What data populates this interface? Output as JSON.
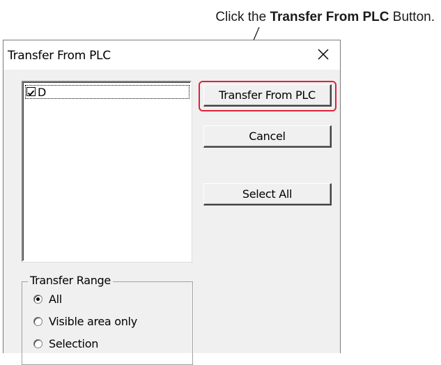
{
  "callout": {
    "prefix": "Click the ",
    "bold": "Transfer From PLC",
    "suffix": " Button."
  },
  "dialog": {
    "title": "Transfer From PLC",
    "close_icon": "close-icon",
    "list": {
      "items": [
        {
          "label": "D",
          "checked": true
        }
      ]
    },
    "buttons": {
      "transfer": "Transfer From PLC",
      "cancel": "Cancel",
      "select_all": "Select All"
    },
    "transfer_range": {
      "label": "Transfer Range",
      "options": [
        {
          "label": "All",
          "selected": true
        },
        {
          "label": "Visible area only",
          "selected": false
        },
        {
          "label": "Selection",
          "selected": false
        }
      ]
    }
  },
  "colors": {
    "highlight": "#e0203a",
    "dialog_bg": "#f0f0f0"
  }
}
